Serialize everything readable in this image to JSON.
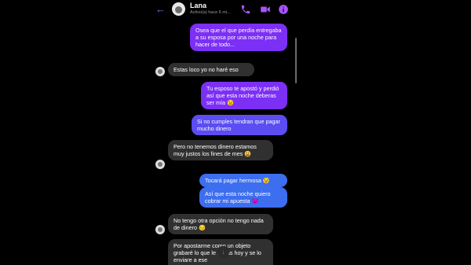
{
  "header": {
    "back_label": "←",
    "contact_name": "Lana",
    "status": "Activo(a) hace 6 mi..."
  },
  "messages": [
    {
      "type": "outgoing",
      "text": "Osea que el que perdía entregaba a su esposa por una noche para hacer de todo..."
    },
    {
      "type": "incoming",
      "text": "Estas loco yo no haré eso"
    },
    {
      "type": "outgoing",
      "text": "Tu esposo te apostó y perdió así que esta noche deberas ser mía 😉"
    },
    {
      "type": "outgoing",
      "text": "Si no cumples tendran que pagar mucho dinero"
    },
    {
      "type": "incoming",
      "text": "Pero no tenemos dinero estamos muy justos los fines de mes 😩"
    },
    {
      "type": "outgoing",
      "text": "Tocará pagar hermosa 😉"
    },
    {
      "type": "outgoing",
      "text": "Así que esta noche quiero cobrar mi apuesta 😈"
    },
    {
      "type": "incoming",
      "text": "No tengo otra opción no tengo nada de dinero 😔"
    },
    {
      "type": "incoming",
      "text": "Por apostarme como un objeto grabaré lo que le hagas hoy y se lo enviare a ese"
    }
  ],
  "down_button_label": "↓",
  "colors": {
    "accent": "#a855f7",
    "outgoing_purple": "#7c2ff5",
    "outgoing_indigo": "#5b4df2",
    "outgoing_blue": "#3d6ef0",
    "incoming": "#303030"
  }
}
